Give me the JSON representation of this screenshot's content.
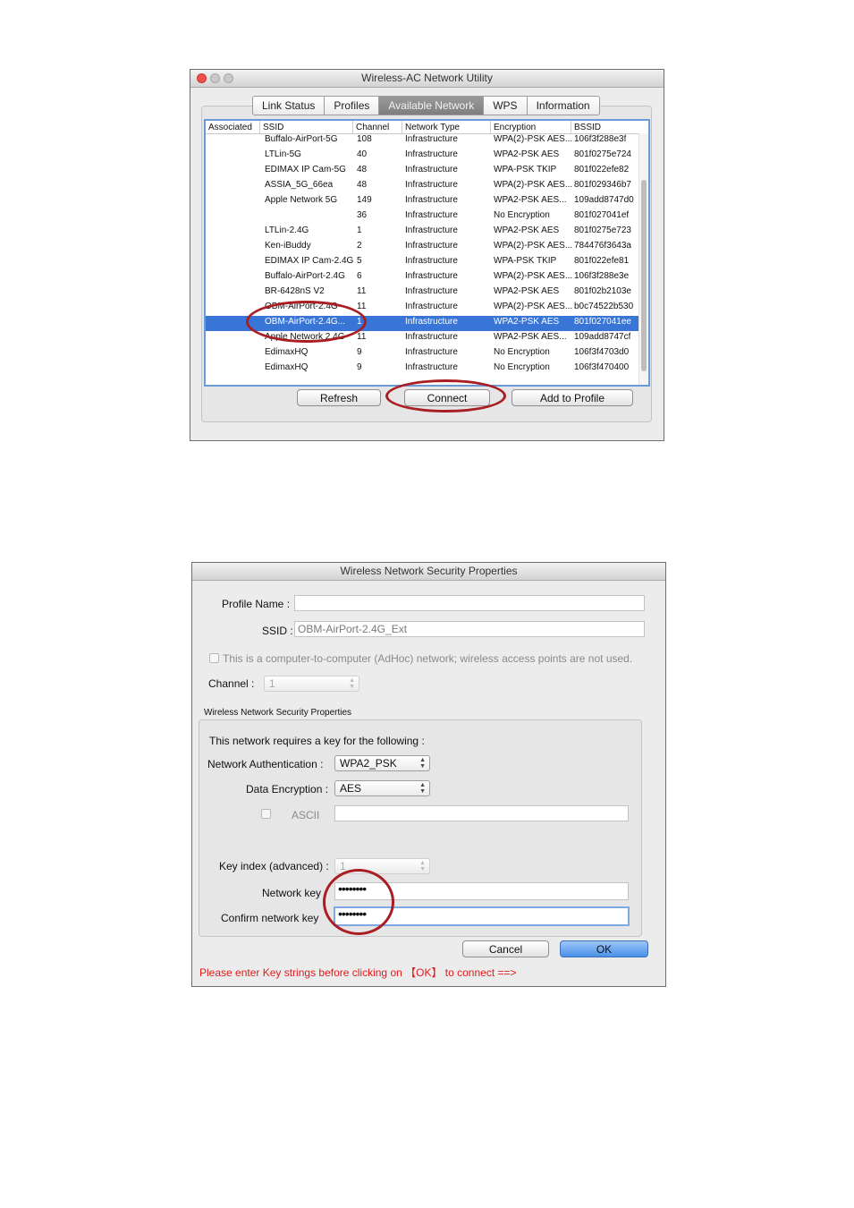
{
  "window1": {
    "title": "Wireless-AC Network Utility",
    "tabs": [
      {
        "label": "Link Status",
        "active": false
      },
      {
        "label": "Profiles",
        "active": false
      },
      {
        "label": "Available Network",
        "active": true
      },
      {
        "label": "WPS",
        "active": false
      },
      {
        "label": "Information",
        "active": false
      }
    ],
    "columns": [
      "Associated",
      "SSID",
      "Channel",
      "Network Type",
      "Encryption",
      "BSSID"
    ],
    "rows": [
      {
        "assoc": "",
        "ssid": "Buffalo-AirPort-5G",
        "channel": "108",
        "type": "Infrastructure",
        "enc": "WPA(2)-PSK AES...",
        "bssid": "106f3f288e3f"
      },
      {
        "assoc": "",
        "ssid": "LTLin-5G",
        "channel": "40",
        "type": "Infrastructure",
        "enc": "WPA2-PSK AES",
        "bssid": "801f0275e724"
      },
      {
        "assoc": "",
        "ssid": "EDIMAX IP Cam-5G",
        "channel": "48",
        "type": "Infrastructure",
        "enc": "WPA-PSK TKIP",
        "bssid": "801f022efe82"
      },
      {
        "assoc": "",
        "ssid": "ASSIA_5G_66ea",
        "channel": "48",
        "type": "Infrastructure",
        "enc": "WPA(2)-PSK AES...",
        "bssid": "801f029346b7"
      },
      {
        "assoc": "",
        "ssid": "Apple Network 5G",
        "channel": "149",
        "type": "Infrastructure",
        "enc": "WPA2-PSK AES...",
        "bssid": "109add8747d0"
      },
      {
        "assoc": "",
        "ssid": "",
        "channel": "36",
        "type": "Infrastructure",
        "enc": "No Encryption",
        "bssid": "801f027041ef"
      },
      {
        "assoc": "",
        "ssid": "LTLin-2.4G",
        "channel": "1",
        "type": "Infrastructure",
        "enc": "WPA2-PSK AES",
        "bssid": "801f0275e723"
      },
      {
        "assoc": "",
        "ssid": "Ken-iBuddy",
        "channel": "2",
        "type": "Infrastructure",
        "enc": "WPA(2)-PSK AES...",
        "bssid": "784476f3643a"
      },
      {
        "assoc": "",
        "ssid": "EDIMAX IP Cam-2.4G",
        "channel": "5",
        "type": "Infrastructure",
        "enc": "WPA-PSK TKIP",
        "bssid": "801f022efe81"
      },
      {
        "assoc": "",
        "ssid": "Buffalo-AirPort-2.4G",
        "channel": "6",
        "type": "Infrastructure",
        "enc": "WPA(2)-PSK AES...",
        "bssid": "106f3f288e3e"
      },
      {
        "assoc": "",
        "ssid": "BR-6428nS V2",
        "channel": "11",
        "type": "Infrastructure",
        "enc": "WPA2-PSK AES",
        "bssid": "801f02b2103e"
      },
      {
        "assoc": "",
        "ssid": "OBM-AirPort-2.4G",
        "channel": "11",
        "type": "Infrastructure",
        "enc": "WPA(2)-PSK AES...",
        "bssid": "b0c74522b530"
      },
      {
        "assoc": "",
        "ssid": "OBM-AirPort-2.4G...",
        "channel": "1",
        "type": "Infrastructure",
        "enc": "WPA2-PSK AES",
        "bssid": "801f027041ee",
        "selected": true
      },
      {
        "assoc": "",
        "ssid": "Apple Network 2.4G",
        "channel": "11",
        "type": "Infrastructure",
        "enc": "WPA2-PSK AES...",
        "bssid": "109add8747cf"
      },
      {
        "assoc": "",
        "ssid": "EdimaxHQ",
        "channel": "9",
        "type": "Infrastructure",
        "enc": "No Encryption",
        "bssid": "106f3f4703d0"
      },
      {
        "assoc": "",
        "ssid": "EdimaxHQ",
        "channel": "9",
        "type": "Infrastructure",
        "enc": "No Encryption",
        "bssid": "106f3f470400"
      }
    ],
    "buttons": {
      "refresh": "Refresh",
      "connect": "Connect",
      "add_to_profile": "Add to Profile"
    }
  },
  "window2": {
    "title": "Wireless Network Security Properties",
    "profile_name_label": "Profile Name :",
    "profile_name_value": "",
    "ssid_label": "SSID :",
    "ssid_value": "OBM-AirPort-2.4G_Ext",
    "adhoc_label": "This is a computer-to-computer (AdHoc) network; wireless access points are not used.",
    "channel_label": "Channel :",
    "channel_value": "1",
    "group_title": "Wireless Network Security Properties",
    "requires_key_text": "This network requires a key for the following :",
    "auth_label": "Network Authentication :",
    "auth_value": "WPA2_PSK",
    "enc_label": "Data Encryption :",
    "enc_value": "AES",
    "ascii_label": "ASCII",
    "ascii_value": "",
    "key_index_label": "Key index (advanced) :",
    "key_index_value": "1",
    "network_key_label": "Network key",
    "network_key_value": "••••••••",
    "confirm_key_label": "Confirm network key",
    "confirm_key_value": "••••••••",
    "cancel_label": "Cancel",
    "ok_label": "OK",
    "note": "Please enter Key strings before clicking on 【OK】 to connect ==>"
  },
  "colors": {
    "selection": "#3875d7",
    "annotation_ring": "#a81e23",
    "note_text": "#e01b1b",
    "ok_button": "#4b91e9"
  }
}
